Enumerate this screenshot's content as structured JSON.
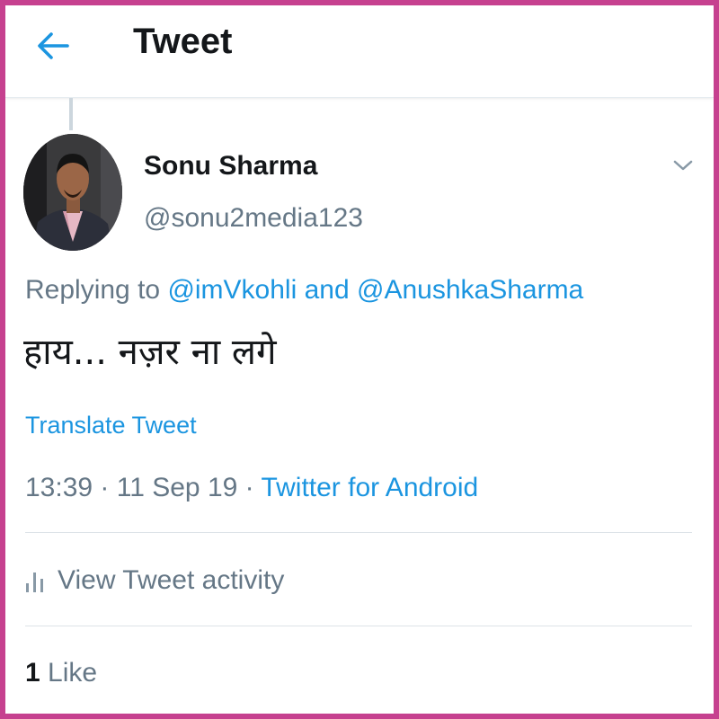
{
  "colors": {
    "border": "#c6418f",
    "accent": "#1b95e0",
    "text_primary": "#14171a",
    "text_secondary": "#657786"
  },
  "header": {
    "back_icon": "arrow-left-icon",
    "title": "Tweet"
  },
  "tweet": {
    "author": {
      "name": "Sonu Sharma",
      "handle": "@sonu2media123"
    },
    "menu_icon": "chevron-down-icon",
    "reply_context": {
      "prefix": "Replying to ",
      "mention_1": "@imVkohli",
      "joiner": " and ",
      "mention_2": "@AnushkaSharma"
    },
    "text": "हाय... नज़र ना लगे",
    "translate_label": "Translate Tweet",
    "meta": {
      "time": "13:39",
      "separator": " · ",
      "date": "11 Sep 19",
      "source": "Twitter for Android"
    },
    "activity": {
      "icon": "bar-chart-icon",
      "label": "View Tweet activity"
    },
    "likes": {
      "count": "1",
      "label": " Like"
    }
  }
}
